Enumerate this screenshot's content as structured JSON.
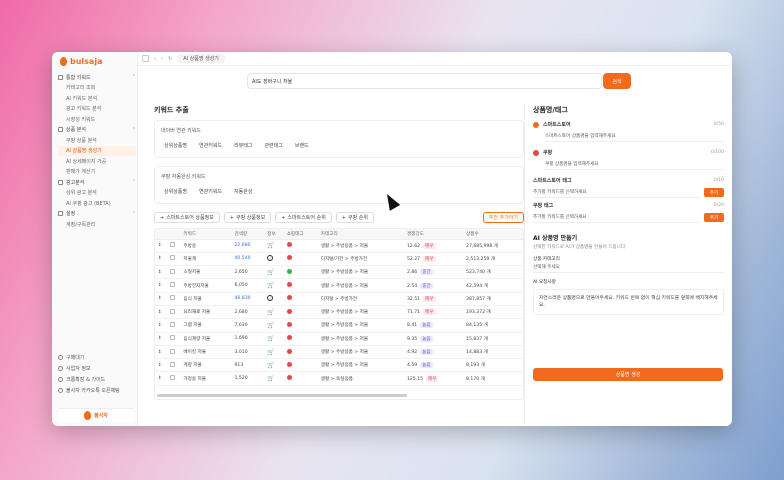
{
  "app": {
    "brand": "bulsaja",
    "tab": "AI 상품명 생성기"
  },
  "search": {
    "value": "AI도 장바구니 저울",
    "button": "검색"
  },
  "sidebar": {
    "items": [
      {
        "type": "group",
        "label": "통합 키워드"
      },
      {
        "type": "sub",
        "label": "카테고리 조회"
      },
      {
        "type": "sub",
        "label": "AI 키워드 분석"
      },
      {
        "type": "sub",
        "label": "광고 키워드 분석"
      },
      {
        "type": "sub",
        "label": "시장성 키워드"
      },
      {
        "type": "group",
        "label": "상품 분석"
      },
      {
        "type": "sub",
        "label": "쿠팡 상품 분석"
      },
      {
        "type": "sub",
        "label": "AI 상품명 생성기",
        "active": true
      },
      {
        "type": "sub",
        "label": "AI 상세페이지 가공"
      },
      {
        "type": "sub",
        "label": "판매가 계산기"
      },
      {
        "type": "group",
        "label": "광고분석"
      },
      {
        "type": "sub",
        "label": "상위 광고 분석"
      },
      {
        "type": "sub",
        "label": "AI 쿠팡 광고 (BETA)"
      },
      {
        "type": "group",
        "label": "설정"
      },
      {
        "type": "sub",
        "label": "계정/구독관리"
      }
    ],
    "bottom": [
      "구매대기",
      "사업자 정보",
      "크롬확장 & 가이드",
      "불사자 카카오톡 오픈채팅"
    ],
    "footer": "불사자"
  },
  "main": {
    "title": "키워드 추출",
    "card1": {
      "title": "네이버 연관 키워드",
      "chips": [
        "상위상품명",
        "연관키워드",
        "리뷰태그",
        "관련태그",
        "브랜드"
      ]
    },
    "card2": {
      "title": "쿠팡 자동완성 키워드",
      "chips": [
        "상위상품명",
        "연관키워드",
        "자동완성"
      ]
    },
    "toolbar": [
      "스마트스토어 상품정보",
      "쿠팡 상품정보",
      "스마트스토어 순위",
      "쿠팡 순위"
    ],
    "toolbar_right": "추천 추가하기",
    "table": {
      "headers": [
        "",
        "",
        "키워드",
        "검색량",
        "정보",
        "쇼핑태그",
        "카테고리",
        "경쟁강도",
        "상품수"
      ],
      "rows": [
        [
          "주방용",
          "22,680",
          "cart",
          "red",
          "생활 > 주방용품 > 저울",
          "12.62",
          "매우",
          "27,685,998 개"
        ],
        [
          "저울계",
          "40,540",
          "info",
          "red",
          "디지털/가전 > 주방가전",
          "52.27",
          "매우",
          "2,513,259 개"
        ],
        [
          "소형저울",
          "2,650",
          "cart",
          "green",
          "생활 > 주방용품 > 저울",
          "2.86",
          "중간",
          "523,740 개"
        ],
        [
          "주방전자저울",
          "6,050",
          "cart",
          "red",
          "생활 > 주방용품 > 저울",
          "2.54",
          "중간",
          "42,594 개"
        ],
        [
          "음식 저울",
          "46,830",
          "info",
          "red",
          "디지털 > 주방가전",
          "32.51",
          "매우",
          "387,857 개"
        ],
        [
          "요리재료 저울",
          "2,680",
          "cart",
          "red",
          "생활 > 주방용품 > 저울",
          "71.71",
          "매우",
          "193,372 개"
        ],
        [
          "그램 저울",
          "7,630",
          "cart",
          "red",
          "생활 > 주방용품 > 저울",
          "8.41",
          "높음",
          "84,135 개"
        ],
        [
          "음식계량 저울",
          "1,690",
          "cart",
          "red",
          "생활 > 주방용품 > 저울",
          "9.35",
          "높음",
          "15,837 개"
        ],
        [
          "베이킹 저울",
          "3,010",
          "cart",
          "red",
          "생활 > 주방용품 > 저울",
          "4.92",
          "높음",
          "14,883 개"
        ],
        [
          "계량 저울",
          "913",
          "cart",
          "red",
          "생활 > 주방용품 > 저울",
          "4.59",
          "높음",
          "8,193 개"
        ],
        [
          "가정용 저울",
          "1,520",
          "cart",
          "red",
          "생활 > 욕실용품",
          "125.15",
          "매우",
          "8,170 개"
        ]
      ]
    }
  },
  "right": {
    "title": "상품명/태그",
    "store1": {
      "name": "스마트스토어",
      "sub": "스마트스토어 상품명을 입력해주세요",
      "meta": "0/50"
    },
    "store2": {
      "name": "쿠팡",
      "sub": "쿠팡 상품명을 입력해주세요",
      "meta": "0/100"
    },
    "tags1": {
      "name": "스마트스토어 태그",
      "sub": "추가할 키워드를 선택하세요",
      "meta": "0/10",
      "btn": "추가"
    },
    "tags2": {
      "name": "쿠팡 태그",
      "sub": "추가할 키워드를 선택하세요",
      "meta": "0/20",
      "btn": "추가"
    },
    "ai_title": "AI 상품명 만들기",
    "ai_desc": "선택한 키워드로 AI가 상품명을 만들어 드립니다.",
    "select_label": "상품 카테고리",
    "select_value": "선택해 주세요",
    "prompt_label": "AI 요청사항",
    "prompt_text": "자연스러운 상품명으로 만들어주세요. 키워드 반복 없이 핵심 키워드를 앞쪽에 배치해주세요.",
    "generate": "상품명 생성"
  },
  "colors": {
    "accent": "#f26b1d",
    "danger": "#e54848",
    "ok": "#2fb34f"
  }
}
